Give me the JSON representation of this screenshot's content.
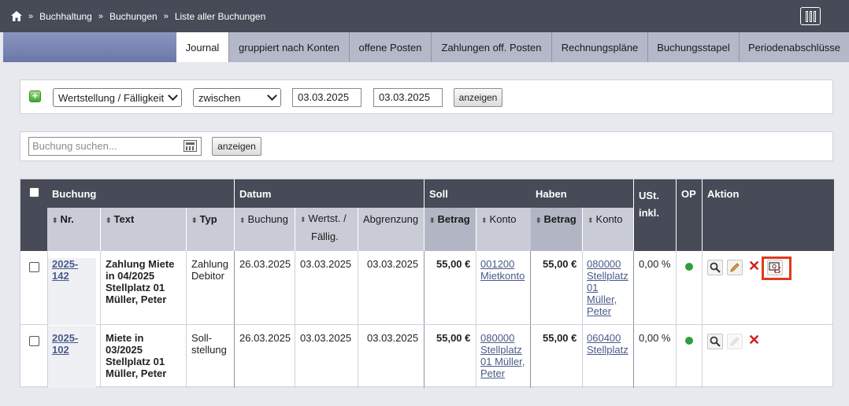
{
  "breadcrumb": {
    "items": [
      "Buchhaltung",
      "Buchungen",
      "Liste aller Buchungen"
    ],
    "separator": "»"
  },
  "tabs": [
    {
      "label": "Journal",
      "active": true
    },
    {
      "label": "gruppiert nach Konten",
      "active": false
    },
    {
      "label": "offene Posten",
      "active": false
    },
    {
      "label": "Zahlungen off. Posten",
      "active": false
    },
    {
      "label": "Rechnungspläne",
      "active": false
    },
    {
      "label": "Buchungsstapel",
      "active": false
    },
    {
      "label": "Periodenabschlüsse",
      "active": false
    }
  ],
  "filter": {
    "field": "Wertstellung / Fälligkeit",
    "operator": "zwischen",
    "date_from": "03.03.2025",
    "date_to": "03.03.2025",
    "show_label": "anzeigen"
  },
  "search": {
    "placeholder": "Buchung suchen...",
    "show_label": "anzeigen"
  },
  "table": {
    "groups": {
      "buchung": "Buchung",
      "datum": "Datum",
      "soll": "Soll",
      "haben": "Haben",
      "ust": "USt.",
      "ust2": "inkl.",
      "op": "OP",
      "aktion": "Aktion"
    },
    "columns": {
      "nr": "Nr.",
      "text": "Text",
      "typ": "Typ",
      "buchung": "Buchung",
      "wertst": "Wertst. /",
      "wertst2": "Fällig.",
      "abgrenzung": "Abgrenzung",
      "soll_betrag": "Betrag",
      "soll_konto": "Konto",
      "haben_betrag": "Betrag",
      "haben_konto": "Konto"
    },
    "rows": [
      {
        "nr": "2025-142",
        "text": [
          "Zahlung Miete",
          "in 04/2025",
          "Stellplatz 01",
          "Müller, Peter"
        ],
        "typ": [
          "Zahlung",
          "Debitor"
        ],
        "buchung": "26.03.2025",
        "wertst": "03.03.2025",
        "abgrenzung": "03.03.2025",
        "soll_betrag": "55,00 €",
        "soll_konto": [
          "001200",
          "Mietkonto"
        ],
        "haben_betrag": "55,00 €",
        "haben_konto": [
          "080000",
          "Stellplatz",
          "01",
          "Müller,",
          "Peter"
        ],
        "ust": "0,00 %",
        "op_color": "#2e9e3e"
      },
      {
        "nr": "2025-102",
        "text": [
          "Miete in",
          "03/2025",
          "Stellplatz 01",
          "Müller, Peter"
        ],
        "typ": [
          "Soll-",
          "stellung"
        ],
        "buchung": "26.03.2025",
        "wertst": "03.03.2025",
        "abgrenzung": "03.03.2025",
        "soll_betrag": "55,00 €",
        "soll_konto": [
          "080000",
          "Stellplatz",
          "01 Müller,",
          "Peter"
        ],
        "haben_betrag": "55,00 €",
        "haben_konto": [
          "060400",
          "Stellplatz"
        ],
        "ust": "0,00 %",
        "op_color": "#2e9e3e"
      }
    ]
  },
  "colors": {
    "topbar": "#474b57",
    "header": "#474b57",
    "subheader": "#c9ccd7",
    "highlight": "#e03a1e",
    "op_ok": "#2e9e3e"
  }
}
